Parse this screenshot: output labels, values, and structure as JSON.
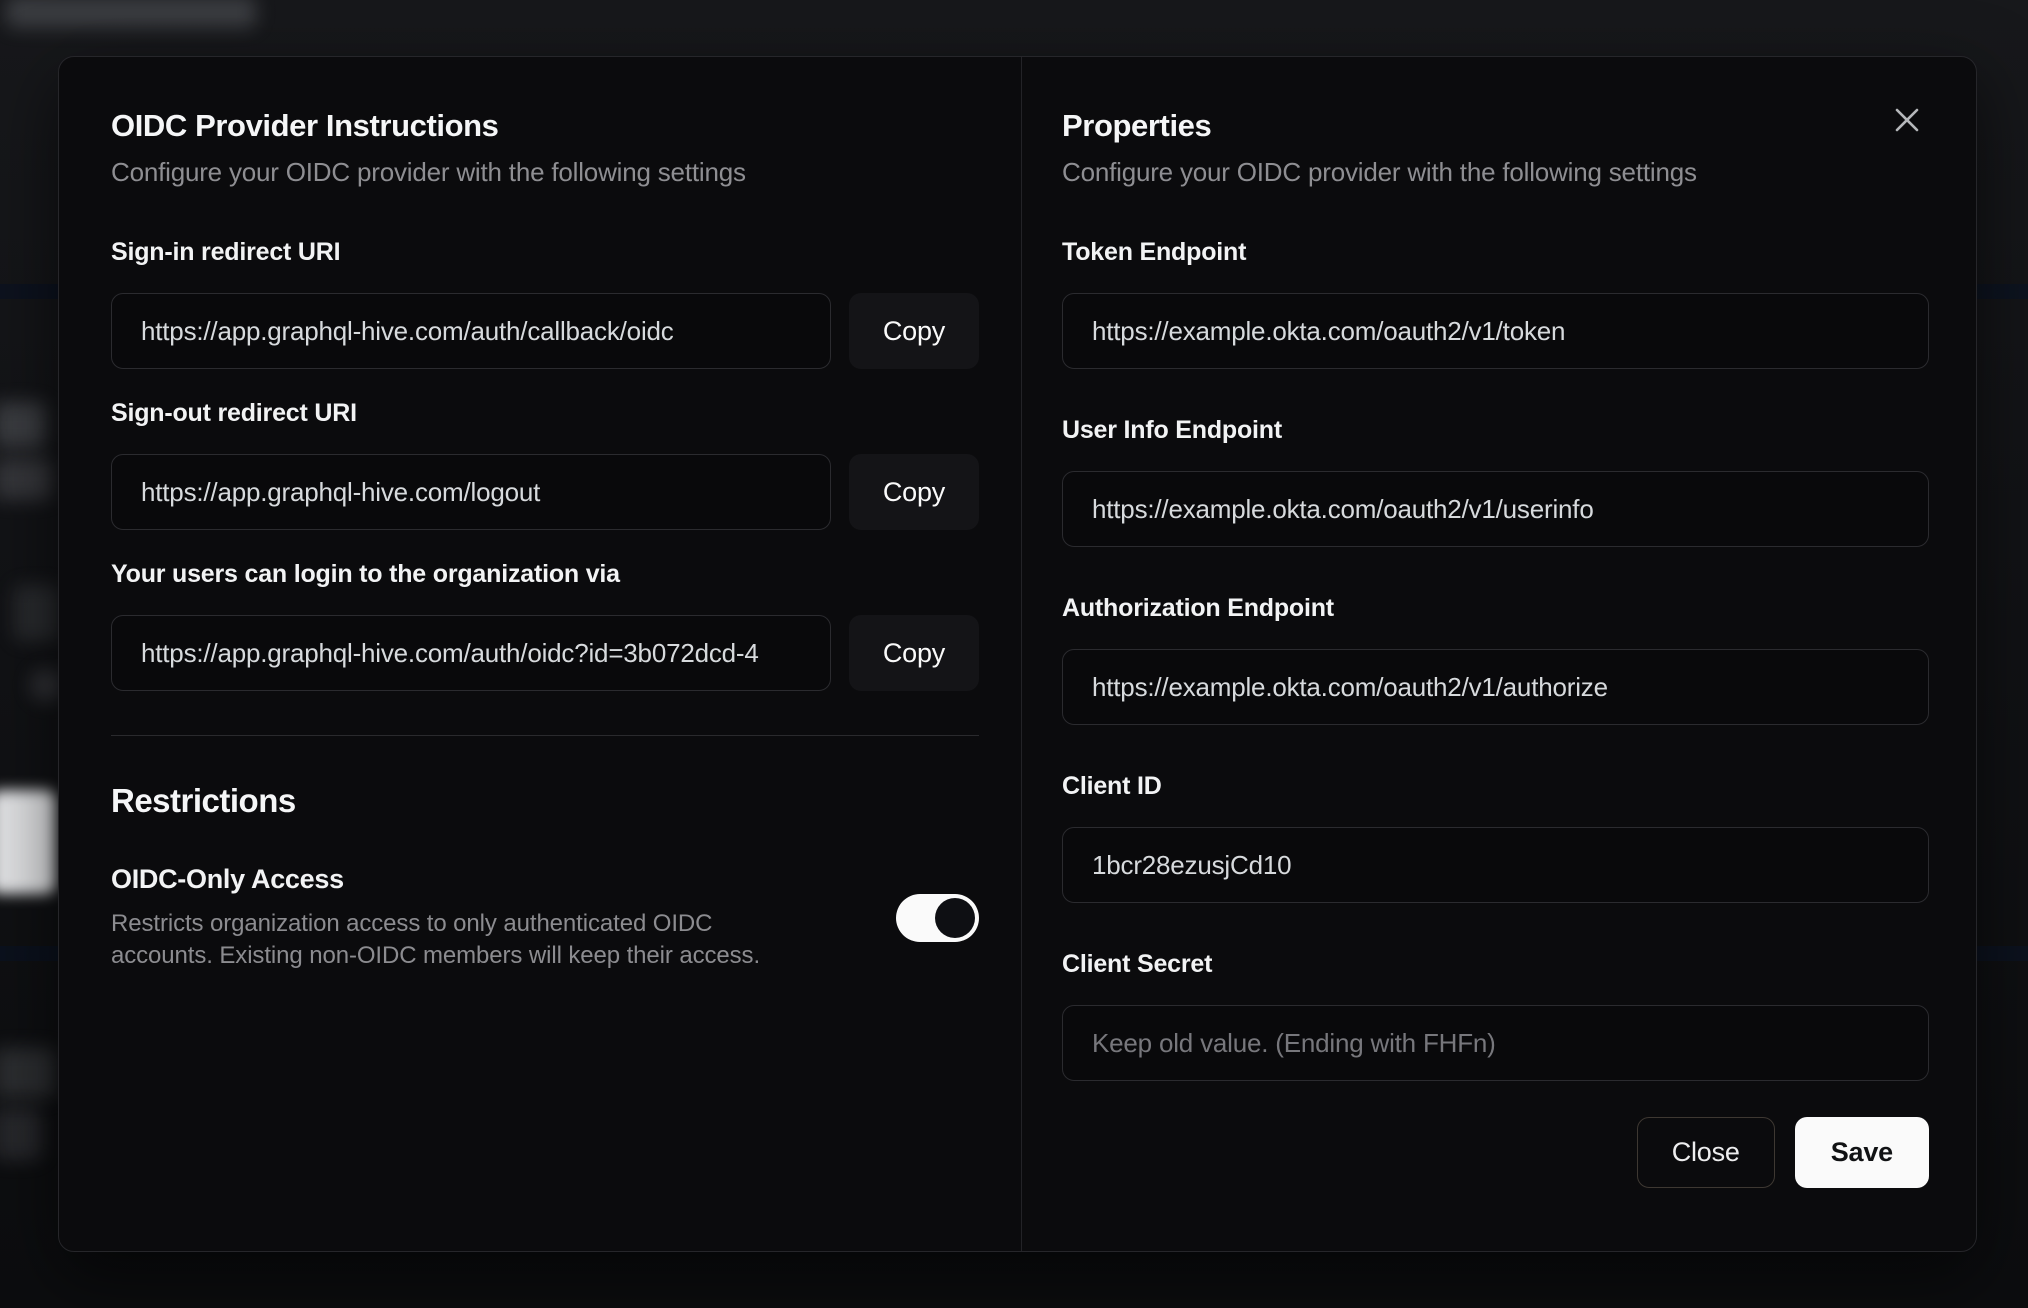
{
  "colors": {
    "page_background": "#121316",
    "modal_background": "#0b0b0d",
    "modal_border": "#26262a",
    "input_border": "#2b2b2f",
    "label_text": "#f2f3f4",
    "muted_text": "#8e8e92",
    "accent_button": "#fafafa",
    "accent_button_text": "#111214",
    "toggle_track": "#fafafa",
    "toggle_knob": "#0e0f13"
  },
  "modal": {
    "close_icon": "x",
    "left": {
      "title": "OIDC Provider Instructions",
      "subtitle": "Configure your OIDC provider with the following settings",
      "fields": [
        {
          "label": "Sign-in redirect URI",
          "value": "https://app.graphql-hive.com/auth/callback/oidc",
          "copy_label": "Copy"
        },
        {
          "label": "Sign-out redirect URI",
          "value": "https://app.graphql-hive.com/logout",
          "copy_label": "Copy"
        },
        {
          "label": "Your users can login to the organization via",
          "value": "https://app.graphql-hive.com/auth/oidc?id=3b072dcd-4",
          "copy_label": "Copy"
        }
      ],
      "restrictions": {
        "title": "Restrictions",
        "toggle_label": "OIDC-Only Access",
        "toggle_description": "Restricts organization access to only authenticated OIDC accounts. Existing non-OIDC members will keep their access.",
        "toggle_state": "on"
      }
    },
    "right": {
      "title": "Properties",
      "subtitle": "Configure your OIDC provider with the following settings",
      "fields": [
        {
          "label": "Token Endpoint",
          "value": "https://example.okta.com/oauth2/v1/token"
        },
        {
          "label": "User Info Endpoint",
          "value": "https://example.okta.com/oauth2/v1/userinfo"
        },
        {
          "label": "Authorization Endpoint",
          "value": "https://example.okta.com/oauth2/v1/authorize"
        },
        {
          "label": "Client ID",
          "value": "1bcr28ezusjCd10"
        },
        {
          "label": "Client Secret",
          "value": "",
          "placeholder": "Keep old value. (Ending with FHFn)"
        }
      ],
      "buttons": {
        "close": "Close",
        "save": "Save"
      }
    }
  }
}
